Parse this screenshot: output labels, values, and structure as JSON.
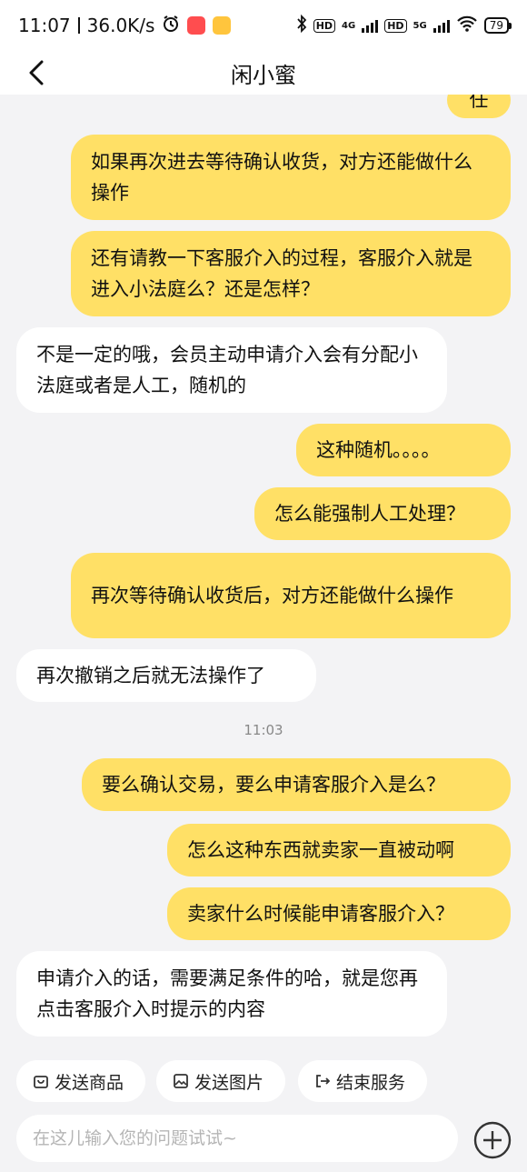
{
  "status": {
    "time": "11:07",
    "speed": "36.0K/s",
    "hd1": "HD",
    "net1": "4G",
    "hd2": "HD",
    "net2": "5G",
    "battery": "79"
  },
  "nav": {
    "title": "闲小蜜"
  },
  "messages": [
    {
      "side": "out",
      "text": "任"
    },
    {
      "side": "out",
      "text": "如果再次进去等待确认收货，对方还能做什么操作"
    },
    {
      "side": "out",
      "text": "还有请教一下客服介入的过程，客服介入就是进入小法庭么？还是怎样？"
    },
    {
      "side": "in",
      "text": "不是一定的哦，会员主动申请介入会有分配小法庭或者是人工，随机的"
    },
    {
      "side": "out",
      "text": "这种随机。。。。"
    },
    {
      "side": "out",
      "text": "怎么能强制人工处理？"
    },
    {
      "side": "out",
      "text": "再次等待确认收货后，对方还能做什么操作"
    },
    {
      "side": "in",
      "text": "再次撤销之后就无法操作了"
    },
    {
      "side": "time",
      "text": "11:03"
    },
    {
      "side": "out",
      "text": "要么确认交易，要么申请客服介入是么？"
    },
    {
      "side": "out",
      "text": "怎么这种东西就卖家一直被动啊"
    },
    {
      "side": "out",
      "text": "卖家什么时候能申请客服介入？"
    },
    {
      "side": "in",
      "text": "申请介入的话，需要满足条件的哈，就是您再点击客服介入时提示的内容"
    }
  ],
  "quick": {
    "send_goods": "发送商品",
    "send_image": "发送图片",
    "end_service": "结束服务"
  },
  "input": {
    "placeholder": "在这儿输入您的问题试试~"
  },
  "colors": {
    "outgoing_bubble": "#ffe066",
    "incoming_bubble": "#ffffff",
    "background": "#f3f3f5"
  }
}
